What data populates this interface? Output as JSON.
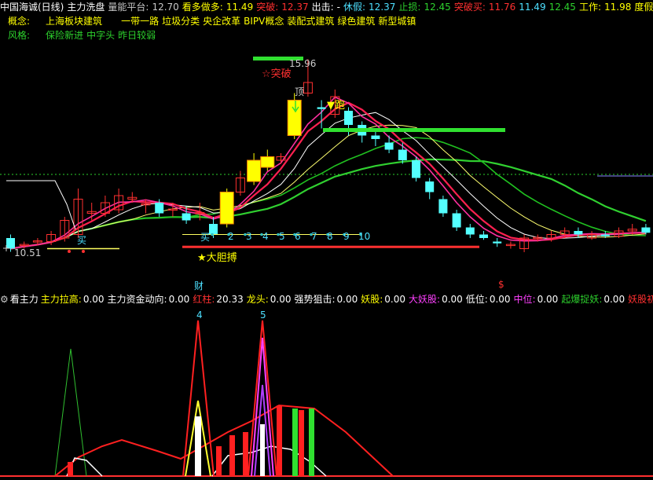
{
  "topbar": {
    "title": "中国海诚(日线)",
    "indicator": "主力洗盘",
    "platform_label": "量能平台:",
    "platform_value": "12.70",
    "bull_label": "看多做多:",
    "bull_value": "11.49",
    "break_label": "突破:",
    "break_value": "12.37",
    "exit_label": "出击:",
    "exit_value": "-",
    "rest_label": "休假:",
    "rest_value": "12.37",
    "stop_label": "止损:",
    "stop_value": "12.45",
    "breakbuy_label": "突破买:",
    "breakbuy_value": "11.76",
    "v1": "11.49",
    "v2": "12.45",
    "work_label": "工作:",
    "work_value": "11.98",
    "holiday_label": "度假"
  },
  "concepts": {
    "label": "概念:",
    "items": [
      "上海板块建筑",
      "一带一路",
      "垃圾分类",
      "央企改革",
      "BIPV概念",
      "装配式建筑",
      "绿色建筑",
      "新型城镇"
    ]
  },
  "style": {
    "label": "风格:",
    "items": [
      "保险新进",
      "中字头",
      "昨日较弱"
    ]
  },
  "annotations": {
    "high_price": "15.96",
    "break_signal": "☆突破",
    "top": "顶",
    "run": "▼跑",
    "low_price": "10.51",
    "buy_low": "买",
    "buy_mid": "买",
    "bold_trade": "★大胆搏",
    "count_labels": [
      "2",
      "3",
      "4",
      "5",
      "6",
      "7",
      "8",
      "9",
      "10"
    ],
    "cai": "财",
    "dollar": "$",
    "peak4": "4",
    "peak5": "5"
  },
  "subbar": {
    "name": "看主力",
    "items": [
      {
        "label": "主力拉高:",
        "value": "0.00",
        "color": "#ffff00"
      },
      {
        "label": "主力资金动向:",
        "value": "0.00",
        "color": "#ffffff"
      },
      {
        "label": "红柱:",
        "value": "20.33",
        "color": "#ff3030"
      },
      {
        "label": "龙头:",
        "value": "0.00",
        "color": "#ffff00"
      },
      {
        "label": "强势狙击:",
        "value": "0.00",
        "color": "#ffffff"
      },
      {
        "label": "妖股:",
        "value": "0.00",
        "color": "#ffff00"
      },
      {
        "label": "大妖股:",
        "value": "0.00",
        "color": "#ff40ff"
      },
      {
        "label": "低位:",
        "value": "0.00",
        "color": "#ffffff"
      },
      {
        "label": "中位:",
        "value": "0.00",
        "color": "#ff40ff"
      },
      {
        "label": "起爆捉妖:",
        "value": "0.00",
        "color": "#2dd12d"
      },
      {
        "label": "妖股初成",
        "value": "",
        "color": "#ff3030"
      }
    ]
  },
  "colors": {
    "background": "#000000",
    "up": "#ff3030",
    "down": "#54ffff",
    "ma_red": "#ff2050",
    "ma_green": "#30d030",
    "ma_white": "#ffffff",
    "ma_yellow": "#ffff60",
    "limit_up": "#ffff00"
  },
  "candles": [
    {
      "o": 10.9,
      "c": 10.6,
      "h": 11.0,
      "l": 10.51
    },
    {
      "o": 10.7,
      "c": 10.72,
      "h": 10.8,
      "l": 10.6
    },
    {
      "o": 10.8,
      "c": 10.82,
      "h": 10.9,
      "l": 10.7
    },
    {
      "o": 10.8,
      "c": 11.0,
      "h": 11.1,
      "l": 10.7
    },
    {
      "o": 10.9,
      "c": 11.4,
      "h": 11.5,
      "l": 10.8
    },
    {
      "o": 11.0,
      "c": 12.0,
      "h": 12.3,
      "l": 10.9
    },
    {
      "o": 11.6,
      "c": 11.65,
      "h": 11.9,
      "l": 11.4
    },
    {
      "o": 11.6,
      "c": 11.9,
      "h": 12.1,
      "l": 11.5
    },
    {
      "o": 11.7,
      "c": 12.1,
      "h": 12.3,
      "l": 11.6
    },
    {
      "o": 12.0,
      "c": 12.05,
      "h": 12.2,
      "l": 11.9
    },
    {
      "o": 11.85,
      "c": 11.87,
      "h": 12.0,
      "l": 11.6
    },
    {
      "o": 11.9,
      "c": 11.6,
      "h": 12.0,
      "l": 11.5
    },
    {
      "o": 11.7,
      "c": 11.72,
      "h": 11.9,
      "l": 11.5
    },
    {
      "o": 11.6,
      "c": 11.4,
      "h": 11.8,
      "l": 11.3
    },
    {
      "o": 11.6,
      "c": 11.62,
      "h": 11.9,
      "l": 11.4
    },
    {
      "o": 11.3,
      "c": 11.0,
      "h": 11.5,
      "l": 10.9
    },
    {
      "o": 11.3,
      "c": 12.2,
      "h": 12.3,
      "l": 11.2,
      "limit": true
    },
    {
      "o": 12.2,
      "c": 12.6,
      "h": 12.8,
      "l": 12.1
    },
    {
      "o": 12.5,
      "c": 13.1,
      "h": 13.3,
      "l": 12.4,
      "limit": true
    },
    {
      "o": 12.9,
      "c": 13.2,
      "h": 13.4,
      "l": 12.8,
      "limit": true
    },
    {
      "o": 13.1,
      "c": 13.2,
      "h": 13.3,
      "l": 13.0
    },
    {
      "o": 13.8,
      "c": 14.8,
      "h": 15.0,
      "l": 13.7,
      "limit": true
    },
    {
      "o": 15.0,
      "c": 15.3,
      "h": 15.96,
      "l": 14.9
    },
    {
      "o": 14.6,
      "c": 14.55,
      "h": 14.8,
      "l": 14.0
    },
    {
      "o": 14.4,
      "c": 14.9,
      "h": 15.1,
      "l": 14.3
    },
    {
      "o": 14.5,
      "c": 14.1,
      "h": 14.6,
      "l": 13.8
    },
    {
      "o": 14.1,
      "c": 13.8,
      "h": 14.2,
      "l": 13.6
    },
    {
      "o": 13.8,
      "c": 13.7,
      "h": 14.0,
      "l": 13.5
    },
    {
      "o": 13.6,
      "c": 13.4,
      "h": 13.8,
      "l": 13.3
    },
    {
      "o": 13.4,
      "c": 13.1,
      "h": 13.6,
      "l": 13.0
    },
    {
      "o": 13.1,
      "c": 12.6,
      "h": 13.2,
      "l": 12.5
    },
    {
      "o": 12.5,
      "c": 12.2,
      "h": 12.6,
      "l": 12.0
    },
    {
      "o": 12.0,
      "c": 11.6,
      "h": 12.1,
      "l": 11.5
    },
    {
      "o": 11.6,
      "c": 11.2,
      "h": 11.7,
      "l": 11.1
    },
    {
      "o": 11.2,
      "c": 11.0,
      "h": 11.3,
      "l": 10.9
    },
    {
      "o": 11.0,
      "c": 10.9,
      "h": 11.1,
      "l": 10.85
    },
    {
      "o": 10.8,
      "c": 10.75,
      "h": 10.9,
      "l": 10.65
    },
    {
      "o": 10.7,
      "c": 10.72,
      "h": 10.8,
      "l": 10.6
    },
    {
      "o": 10.6,
      "c": 10.9,
      "h": 11.0,
      "l": 10.5
    },
    {
      "o": 10.9,
      "c": 10.92,
      "h": 11.0,
      "l": 10.8
    },
    {
      "o": 10.9,
      "c": 11.0,
      "h": 11.1,
      "l": 10.8
    },
    {
      "o": 11.0,
      "c": 11.1,
      "h": 11.2,
      "l": 10.9
    },
    {
      "o": 11.1,
      "c": 11.0,
      "h": 11.2,
      "l": 10.9
    },
    {
      "o": 10.9,
      "c": 11.0,
      "h": 11.1,
      "l": 10.85
    },
    {
      "o": 11.0,
      "c": 10.95,
      "h": 11.1,
      "l": 10.9
    },
    {
      "o": 10.95,
      "c": 11.1,
      "h": 11.2,
      "l": 10.9
    },
    {
      "o": 11.1,
      "c": 11.15,
      "h": 11.3,
      "l": 11.0
    },
    {
      "o": 11.2,
      "c": 11.05,
      "h": 11.3,
      "l": 11.0
    }
  ]
}
